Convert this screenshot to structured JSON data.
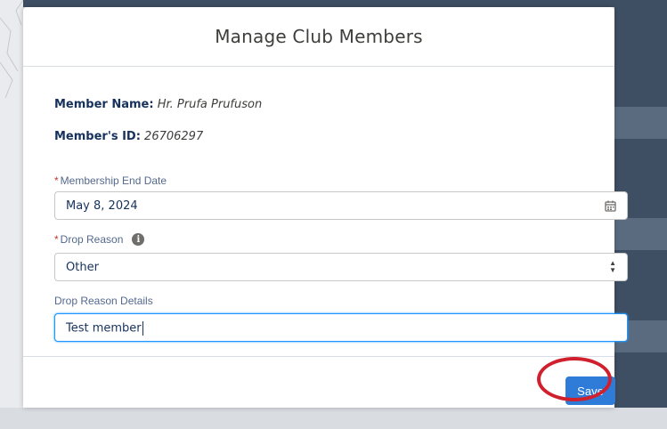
{
  "modal": {
    "title": "Manage Club Members"
  },
  "member": {
    "name_label": "Member Name:",
    "name_value": "Hr. Prufa Prufuson",
    "id_label": "Member's ID:",
    "id_value": "26706297"
  },
  "form": {
    "required_marker": "*",
    "end_date": {
      "label": "Membership End Date",
      "value": "May 8, 2024",
      "icon": "calendar-icon"
    },
    "drop_reason": {
      "label": "Drop Reason",
      "info_icon": "info-icon",
      "info_glyph": "i",
      "selected": "Other"
    },
    "drop_reason_details": {
      "label": "Drop Reason Details",
      "value": "Test member"
    }
  },
  "footer": {
    "save_label": "Save"
  },
  "colors": {
    "accent": "#2f7bd8",
    "required": "#c23934",
    "highlight": "#d0202e",
    "focus": "#1b96ff"
  }
}
